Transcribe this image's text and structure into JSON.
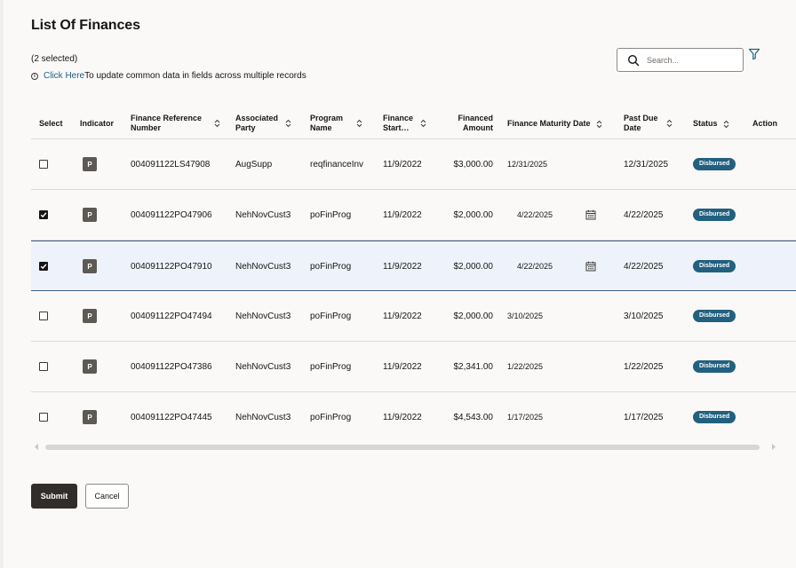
{
  "page": {
    "title": "List Of Finances",
    "selected_count": "(2 selected)",
    "info_link": "Click Here",
    "info_text": "To update common data in fields across multiple records"
  },
  "search": {
    "placeholder": "Search..."
  },
  "table": {
    "headers": {
      "select": "Select",
      "indicator": "Indicator",
      "ref": "Finance Reference Number",
      "party": "Associated Party",
      "program": "Program Name",
      "start": "Finance Start…",
      "amount": "Financed Amount",
      "maturity": "Finance Maturity Date",
      "pastdue": "Past Due Date",
      "status": "Status",
      "action": "Action"
    },
    "rows": [
      {
        "checked": false,
        "indicator": "P",
        "ref": "004091122LS47908",
        "party": "AugSupp",
        "program": "reqfinanceInv",
        "start": "11/9/2022",
        "amount": "$3,000.00",
        "maturity": "12/31/2025",
        "maturity_editable": false,
        "pastdue": "12/31/2025",
        "status": "Disbursed"
      },
      {
        "checked": true,
        "indicator": "P",
        "ref": "004091122PO47906",
        "party": "NehNovCust3",
        "program": "poFinProg",
        "start": "11/9/2022",
        "amount": "$2,000.00",
        "maturity": "4/22/2025",
        "maturity_editable": true,
        "pastdue": "4/22/2025",
        "status": "Disbursed"
      },
      {
        "checked": true,
        "indicator": "P",
        "ref": "004091122PO47910",
        "party": "NehNovCust3",
        "program": "poFinProg",
        "start": "11/9/2022",
        "amount": "$2,000.00",
        "maturity": "4/22/2025",
        "maturity_editable": true,
        "pastdue": "4/22/2025",
        "status": "Disbursed"
      },
      {
        "checked": false,
        "indicator": "P",
        "ref": "004091122PO47494",
        "party": "NehNovCust3",
        "program": "poFinProg",
        "start": "11/9/2022",
        "amount": "$2,000.00",
        "maturity": "3/10/2025",
        "maturity_editable": false,
        "pastdue": "3/10/2025",
        "status": "Disbursed"
      },
      {
        "checked": false,
        "indicator": "P",
        "ref": "004091122PO47386",
        "party": "NehNovCust3",
        "program": "poFinProg",
        "start": "11/9/2022",
        "amount": "$2,341.00",
        "maturity": "1/22/2025",
        "maturity_editable": false,
        "pastdue": "1/22/2025",
        "status": "Disbursed"
      },
      {
        "checked": false,
        "indicator": "P",
        "ref": "004091122PO47445",
        "party": "NehNovCust3",
        "program": "poFinProg",
        "start": "11/9/2022",
        "amount": "$4,543.00",
        "maturity": "1/17/2025",
        "maturity_editable": false,
        "pastdue": "1/17/2025",
        "status": "Disbursed"
      }
    ]
  },
  "buttons": {
    "submit": "Submit",
    "cancel": "Cancel"
  },
  "colors": {
    "accent": "#1a5f8a",
    "status_badge": "#22607f",
    "primary_button": "#312d2a"
  }
}
